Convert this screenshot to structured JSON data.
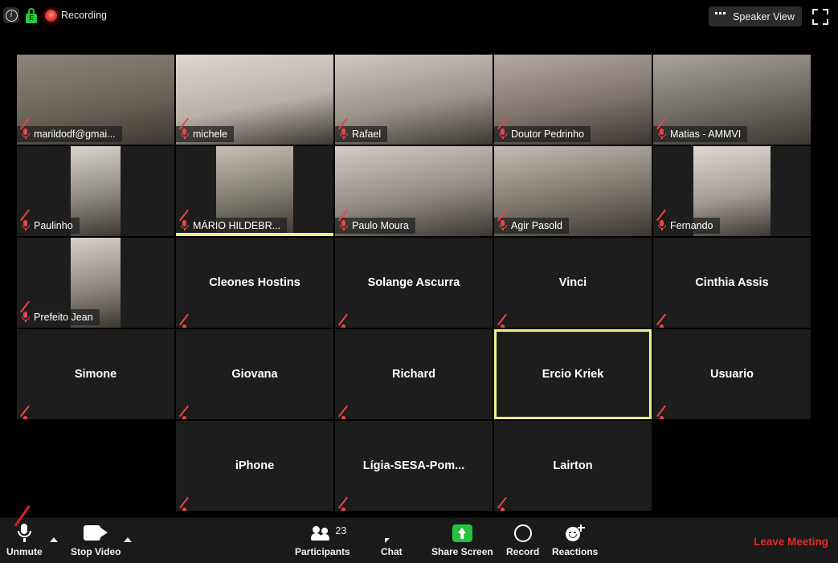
{
  "app": {
    "name": "Zoom Meeting",
    "background_color": "#000000",
    "tile_color": "#1d1d1d",
    "active_speaker_color": "#f2f08a",
    "accent_green": "#25c244",
    "leave_color": "#e02a2a"
  },
  "topbar": {
    "info_icon": "info-icon",
    "info_glyph": "i",
    "encryption_icon": "lock-icon",
    "encryption_glyph": "E",
    "recording_indicator_icon": "recording-dot-icon",
    "recording_label": "Recording",
    "view_button_label": "Speaker View",
    "view_button_icon": "grid-view-icon",
    "fullscreen_icon": "fullscreen-icon"
  },
  "grid": {
    "columns": 5,
    "rows": 5,
    "rows_data": [
      [
        {
          "name": "marildodf@gmai...",
          "video": true,
          "video_style": "full",
          "muted": true,
          "active": false,
          "label_position": "overlay"
        },
        {
          "name": "michele",
          "video": true,
          "video_style": "full",
          "muted": true,
          "active": false,
          "label_position": "overlay"
        },
        {
          "name": "Rafael",
          "video": true,
          "video_style": "full",
          "muted": true,
          "active": false,
          "label_position": "overlay"
        },
        {
          "name": "Doutor Pedrinho",
          "video": true,
          "video_style": "full",
          "muted": true,
          "active": false,
          "label_position": "overlay"
        },
        {
          "name": "Matias - AMMVI",
          "video": true,
          "video_style": "full",
          "muted": true,
          "active": false,
          "label_position": "overlay"
        }
      ],
      [
        {
          "name": "Paulinho",
          "video": true,
          "video_style": "portrait",
          "muted": true,
          "active": false,
          "label_position": "overlay"
        },
        {
          "name": "MÁRIO HILDEBR...",
          "video": true,
          "video_style": "portrait-wide",
          "muted": true,
          "active": true,
          "label_position": "overlay"
        },
        {
          "name": "Paulo Moura",
          "video": true,
          "video_style": "full",
          "muted": true,
          "active": false,
          "label_position": "overlay"
        },
        {
          "name": "Agir Pasold",
          "video": true,
          "video_style": "full",
          "muted": true,
          "active": false,
          "label_position": "overlay"
        },
        {
          "name": "Fernando",
          "video": true,
          "video_style": "portrait-wide",
          "muted": true,
          "active": false,
          "label_position": "overlay"
        }
      ],
      [
        {
          "name": "Prefeito Jean",
          "video": true,
          "video_style": "portrait",
          "muted": true,
          "active": false,
          "label_position": "overlay"
        },
        {
          "name": "Cleones Hostins",
          "video": false,
          "video_style": "none",
          "muted": true,
          "active": false,
          "label_position": "center"
        },
        {
          "name": "Solange  Ascurra",
          "video": false,
          "video_style": "none",
          "muted": true,
          "active": false,
          "label_position": "center"
        },
        {
          "name": "Vinci",
          "video": false,
          "video_style": "none",
          "muted": true,
          "active": false,
          "label_position": "center"
        },
        {
          "name": "Cinthia Assis",
          "video": false,
          "video_style": "none",
          "muted": true,
          "active": false,
          "label_position": "center"
        }
      ],
      [
        {
          "name": "Simone",
          "video": false,
          "video_style": "none",
          "muted": true,
          "active": false,
          "label_position": "center"
        },
        {
          "name": "Giovana",
          "video": false,
          "video_style": "none",
          "muted": true,
          "active": false,
          "label_position": "center"
        },
        {
          "name": "Richard",
          "video": false,
          "video_style": "none",
          "muted": true,
          "active": false,
          "label_position": "center"
        },
        {
          "name": "Ercio Kriek",
          "video": false,
          "video_style": "none",
          "muted": false,
          "active": true,
          "label_position": "center"
        },
        {
          "name": "Usuario",
          "video": false,
          "video_style": "none",
          "muted": true,
          "active": false,
          "label_position": "center"
        }
      ],
      [
        {
          "name": "",
          "video": false,
          "video_style": "none",
          "muted": false,
          "active": false,
          "label_position": "empty"
        },
        {
          "name": "iPhone",
          "video": false,
          "video_style": "none",
          "muted": true,
          "active": false,
          "label_position": "center"
        },
        {
          "name": "Lígia-SESA-Pom...",
          "video": false,
          "video_style": "none",
          "muted": true,
          "active": false,
          "label_position": "center"
        },
        {
          "name": "Lairton",
          "video": false,
          "video_style": "none",
          "muted": true,
          "active": false,
          "label_position": "center"
        },
        {
          "name": "",
          "video": false,
          "video_style": "none",
          "muted": false,
          "active": false,
          "label_position": "empty"
        }
      ]
    ]
  },
  "toolbar": {
    "audio_label": "Unmute",
    "audio_icon": "microphone-muted-icon",
    "audio_caret_icon": "chevron-up-icon",
    "video_label": "Stop Video",
    "video_icon": "camera-icon",
    "video_caret_icon": "chevron-up-icon",
    "participants_label": "Participants",
    "participants_icon": "people-icon",
    "participants_count": "23",
    "chat_label": "Chat",
    "chat_icon": "chat-bubble-icon",
    "share_label": "Share Screen",
    "share_icon": "share-screen-up-arrow-icon",
    "record_label": "Record",
    "record_icon": "record-circle-icon",
    "reactions_label": "Reactions",
    "reactions_icon": "smiley-plus-icon",
    "leave_label": "Leave Meeting"
  }
}
